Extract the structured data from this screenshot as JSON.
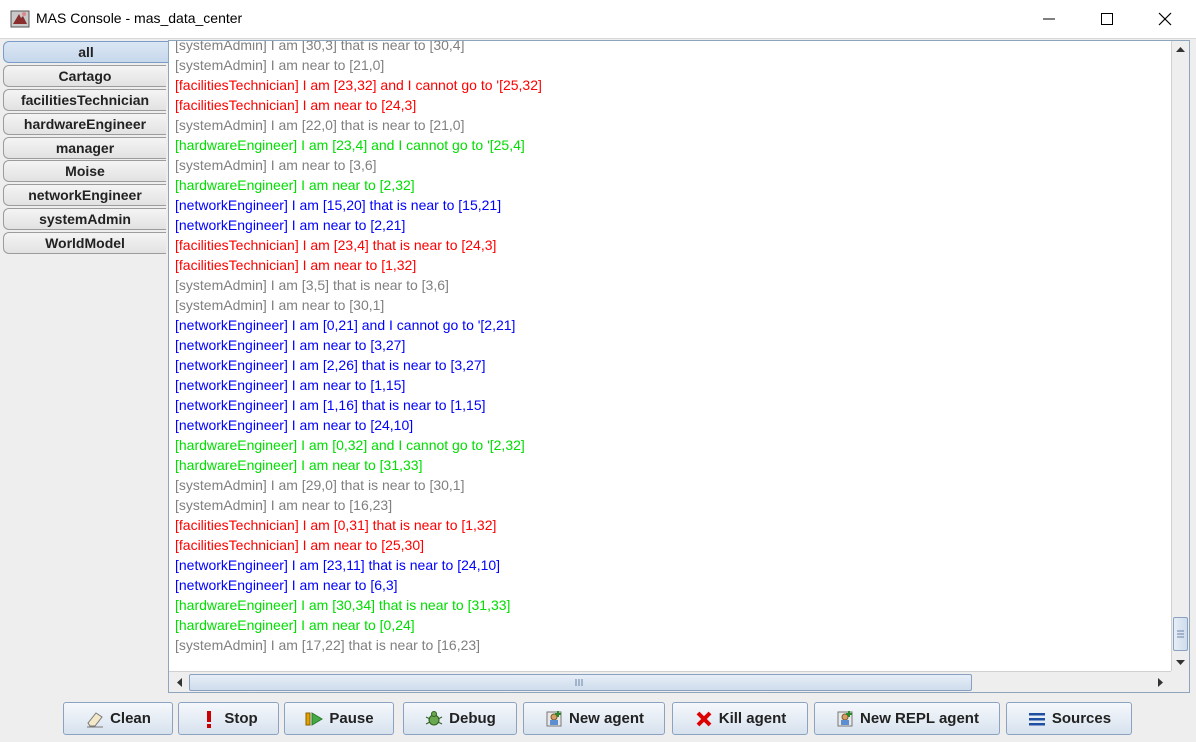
{
  "window": {
    "title": "MAS Console - mas_data_center",
    "icon": "mas-console-icon",
    "controls": [
      "minimize-icon",
      "maximize-icon",
      "close-icon"
    ]
  },
  "tabs": [
    {
      "label": "all",
      "selected": true
    },
    {
      "label": "Cartago",
      "selected": false
    },
    {
      "label": "facilitiesTechnician",
      "selected": false
    },
    {
      "label": "hardwareEngineer",
      "selected": false
    },
    {
      "label": "manager",
      "selected": false
    },
    {
      "label": "Moise",
      "selected": false
    },
    {
      "label": "networkEngineer",
      "selected": false
    },
    {
      "label": "systemAdmin",
      "selected": false
    },
    {
      "label": "WorldModel",
      "selected": false
    }
  ],
  "colors": {
    "systemAdmin": "#808080",
    "facilitiesTechnician": "#ff0000",
    "hardwareEngineer": "#00dd00",
    "networkEngineer": "#0000ff"
  },
  "log": [
    {
      "agent": "systemAdmin",
      "text": "[systemAdmin] I am [30,3] that is near to [30,4]"
    },
    {
      "agent": "systemAdmin",
      "text": "[systemAdmin] I am near to [21,0]"
    },
    {
      "agent": "facilitiesTechnician",
      "text": "[facilitiesTechnician] I am [23,32] and I cannot go to '[25,32]"
    },
    {
      "agent": "facilitiesTechnician",
      "text": "[facilitiesTechnician] I am near to [24,3]"
    },
    {
      "agent": "systemAdmin",
      "text": "[systemAdmin] I am [22,0] that is near to [21,0]"
    },
    {
      "agent": "hardwareEngineer",
      "text": "[hardwareEngineer] I am [23,4] and I cannot go to '[25,4]"
    },
    {
      "agent": "systemAdmin",
      "text": "[systemAdmin] I am near to [3,6]"
    },
    {
      "agent": "hardwareEngineer",
      "text": "[hardwareEngineer] I am near to [2,32]"
    },
    {
      "agent": "networkEngineer",
      "text": "[networkEngineer] I am [15,20] that is near to [15,21]"
    },
    {
      "agent": "networkEngineer",
      "text": "[networkEngineer] I am near to [2,21]"
    },
    {
      "agent": "facilitiesTechnician",
      "text": "[facilitiesTechnician] I am [23,4] that is near to [24,3]"
    },
    {
      "agent": "facilitiesTechnician",
      "text": "[facilitiesTechnician] I am near to [1,32]"
    },
    {
      "agent": "systemAdmin",
      "text": "[systemAdmin] I am [3,5] that is near to [3,6]"
    },
    {
      "agent": "systemAdmin",
      "text": "[systemAdmin] I am near to [30,1]"
    },
    {
      "agent": "networkEngineer",
      "text": "[networkEngineer] I am [0,21] and I cannot go to '[2,21]"
    },
    {
      "agent": "networkEngineer",
      "text": "[networkEngineer] I am near to [3,27]"
    },
    {
      "agent": "networkEngineer",
      "text": "[networkEngineer] I am [2,26] that is near to [3,27]"
    },
    {
      "agent": "networkEngineer",
      "text": "[networkEngineer] I am near to [1,15]"
    },
    {
      "agent": "networkEngineer",
      "text": "[networkEngineer] I am [1,16] that is near to [1,15]"
    },
    {
      "agent": "networkEngineer",
      "text": "[networkEngineer] I am near to [24,10]"
    },
    {
      "agent": "hardwareEngineer",
      "text": "[hardwareEngineer] I am [0,32] and I cannot go to '[2,32]"
    },
    {
      "agent": "hardwareEngineer",
      "text": "[hardwareEngineer] I am near to [31,33]"
    },
    {
      "agent": "systemAdmin",
      "text": "[systemAdmin] I am [29,0] that is near to [30,1]"
    },
    {
      "agent": "systemAdmin",
      "text": "[systemAdmin] I am near to [16,23]"
    },
    {
      "agent": "facilitiesTechnician",
      "text": "[facilitiesTechnician] I am [0,31] that is near to [1,32]"
    },
    {
      "agent": "facilitiesTechnician",
      "text": "[facilitiesTechnician] I am near to [25,30]"
    },
    {
      "agent": "networkEngineer",
      "text": "[networkEngineer] I am [23,11] that is near to [24,10]"
    },
    {
      "agent": "networkEngineer",
      "text": "[networkEngineer] I am near to [6,3]"
    },
    {
      "agent": "hardwareEngineer",
      "text": "[hardwareEngineer] I am [30,34] that is near to [31,33]"
    },
    {
      "agent": "hardwareEngineer",
      "text": "[hardwareEngineer] I am near to [0,24]"
    },
    {
      "agent": "systemAdmin",
      "text": "[systemAdmin] I am [17,22] that is near to [16,23]"
    }
  ],
  "buttons": {
    "clean": {
      "label": "Clean",
      "icon": "eraser-icon"
    },
    "stop": {
      "label": "Stop",
      "icon": "exclamation-icon"
    },
    "pause": {
      "label": "Pause",
      "icon": "pause-icon"
    },
    "debug": {
      "label": "Debug",
      "icon": "bug-icon"
    },
    "new_agent": {
      "label": "New agent",
      "icon": "add-agent-icon"
    },
    "kill_agent": {
      "label": "Kill agent",
      "icon": "kill-icon"
    },
    "new_repl_agent": {
      "label": "New REPL agent",
      "icon": "add-repl-agent-icon"
    },
    "sources": {
      "label": "Sources",
      "icon": "list-icon"
    }
  }
}
